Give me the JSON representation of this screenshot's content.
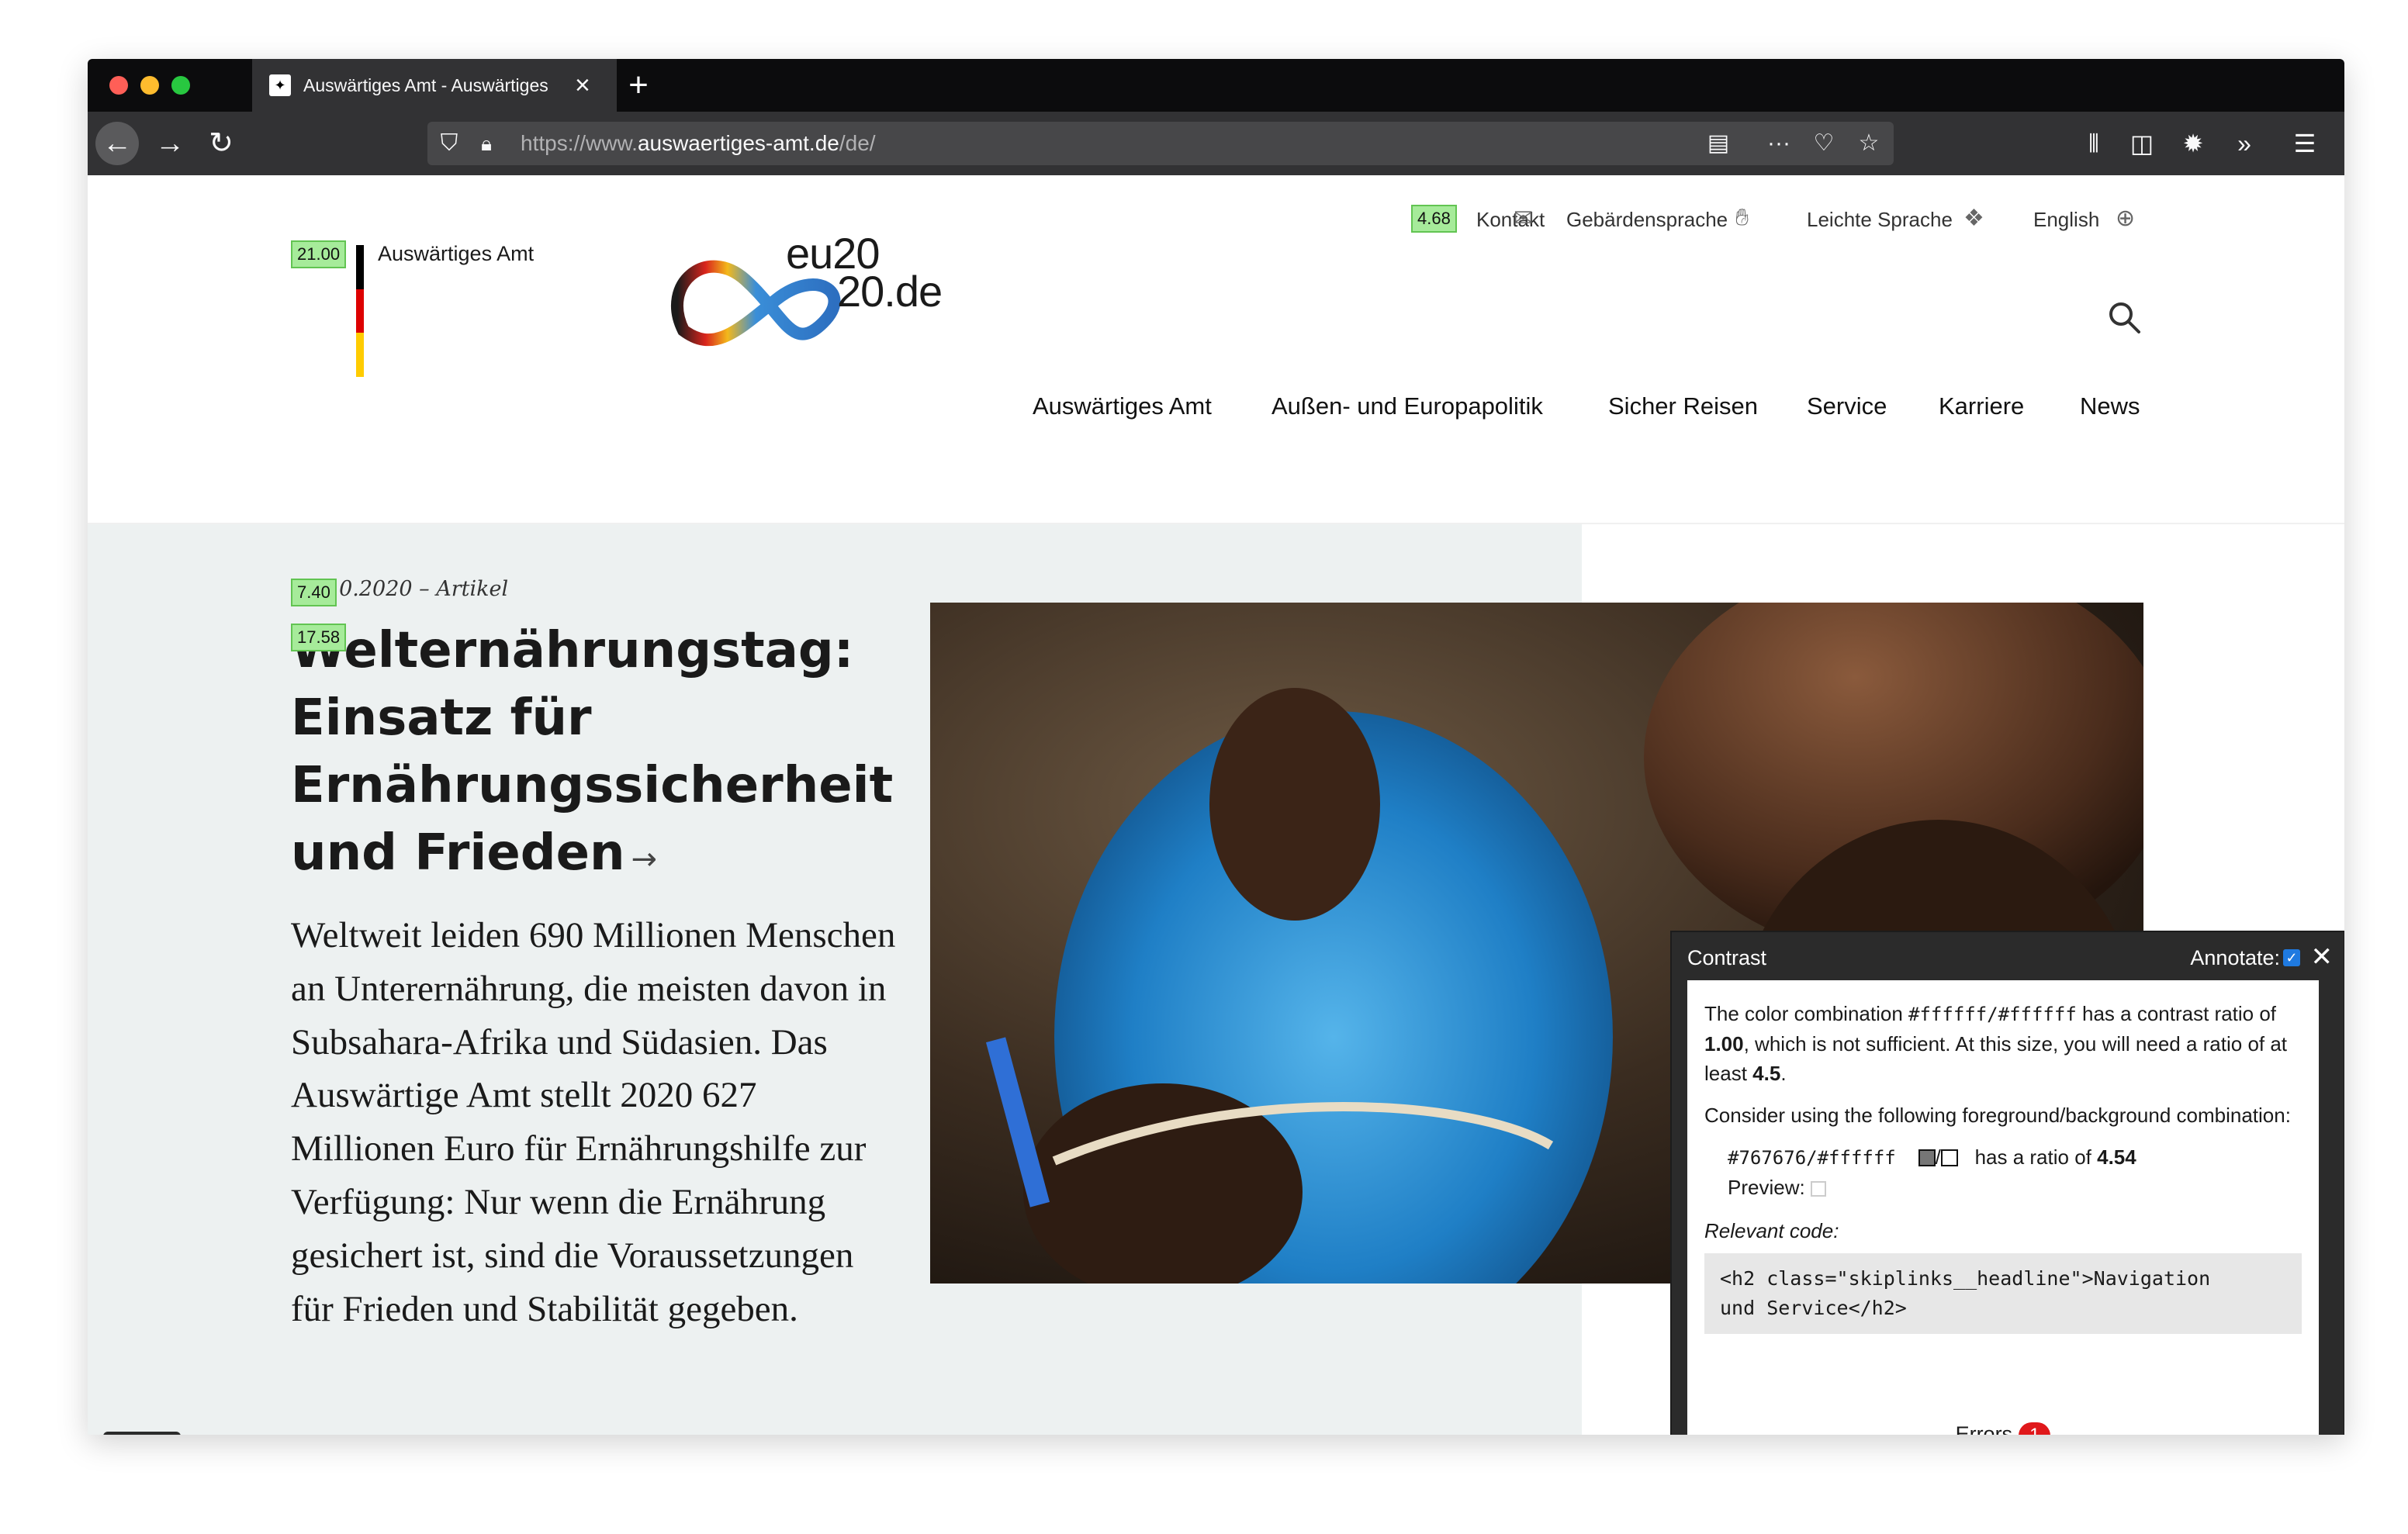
{
  "browser": {
    "tab_title": "Auswärtiges Amt - Auswärtiges",
    "url_prefix": "https://www.",
    "url_domain": "auswaertiges-amt.de",
    "url_path": "/de/"
  },
  "header": {
    "brand_name": "Auswärtiges Amt",
    "eu_line1": "eu20",
    "eu_line2": "20.de",
    "utility_links": [
      {
        "label": "Kontakt"
      },
      {
        "label": "Gebärdensprache"
      },
      {
        "label": "Leichte Sprache"
      },
      {
        "label": "English"
      }
    ],
    "main_nav": [
      "Auswärtiges Amt",
      "Außen- und Europapolitik",
      "Sicher Reisen",
      "Service",
      "Karriere",
      "News"
    ]
  },
  "contrast_badges": {
    "brand": "21.00",
    "utility": "4.68",
    "meta": "7.40",
    "headline": "17.58"
  },
  "article": {
    "meta": "16.10.2020 – Artikel",
    "headline": "Welternährungstag: Einsatz für Ernährungssicherheit und Frieden",
    "arrow": "→",
    "lead": "Weltweit leiden 690 Millionen Menschen an Unterernährung, die meisten davon in Subsahara-Afrika und Südasien. Das Auswärtige Amt stellt 2020 627 Millionen Euro für Ernährungshilfe zur Verfügung: Nur wenn die Ernährung gesichert ist, sind die Voraussetzungen für Frieden und Stabilität gegeben."
  },
  "contrast_panel": {
    "title": "Contrast",
    "annotate_label": "Annotate:",
    "annotate_checked": true,
    "msg_part1": "The color combination ",
    "msg_combo": "#ffffff/#ffffff",
    "msg_part2": " has a contrast ratio of ",
    "msg_ratio": "1.00",
    "msg_part3": ", which is not sufficient. At this size, you will need a ratio of at least ",
    "msg_required": "4.5",
    "msg_end": ".",
    "consider": "Consider using the following foreground/background combination:",
    "suggest_combo": "#767676/#ffffff",
    "suggest_sep": "/",
    "suggest_text": "has a ratio of ",
    "suggest_ratio": "4.54",
    "suggest_fg": "#767676",
    "suggest_bg": "#ffffff",
    "preview_label": "Preview:",
    "relevant_label": "Relevant code:",
    "code_line1": "<h2 class=\"skiplinks__headline\">Navigation",
    "code_line2": "und Service</h2>",
    "errors_label": "Errors",
    "errors_count": "1"
  },
  "colors": {
    "accent_badge": "#a6eb9a",
    "hero_bg": "#edf1f1",
    "error_red": "#e0181b"
  }
}
